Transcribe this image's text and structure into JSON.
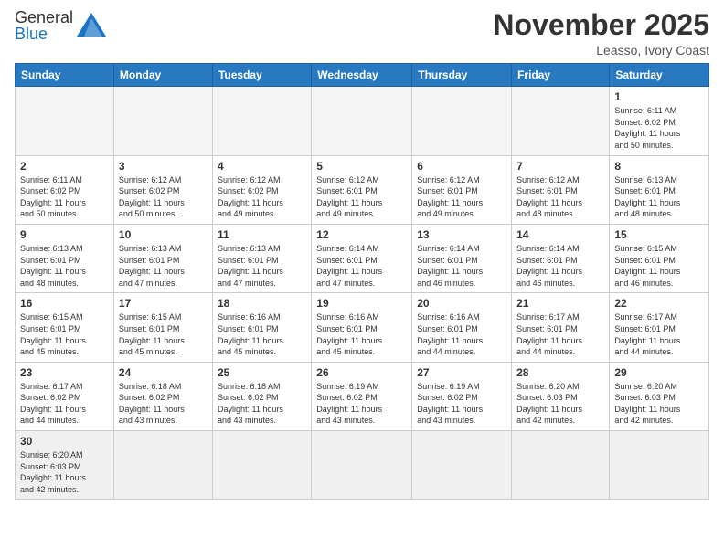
{
  "logo": {
    "text_general": "General",
    "text_blue": "Blue"
  },
  "title": "November 2025",
  "subtitle": "Leasso, Ivory Coast",
  "weekdays": [
    "Sunday",
    "Monday",
    "Tuesday",
    "Wednesday",
    "Thursday",
    "Friday",
    "Saturday"
  ],
  "weeks": [
    [
      {
        "day": "",
        "info": ""
      },
      {
        "day": "",
        "info": ""
      },
      {
        "day": "",
        "info": ""
      },
      {
        "day": "",
        "info": ""
      },
      {
        "day": "",
        "info": ""
      },
      {
        "day": "",
        "info": ""
      },
      {
        "day": "1",
        "info": "Sunrise: 6:11 AM\nSunset: 6:02 PM\nDaylight: 11 hours\nand 50 minutes."
      }
    ],
    [
      {
        "day": "2",
        "info": "Sunrise: 6:11 AM\nSunset: 6:02 PM\nDaylight: 11 hours\nand 50 minutes."
      },
      {
        "day": "3",
        "info": "Sunrise: 6:12 AM\nSunset: 6:02 PM\nDaylight: 11 hours\nand 50 minutes."
      },
      {
        "day": "4",
        "info": "Sunrise: 6:12 AM\nSunset: 6:02 PM\nDaylight: 11 hours\nand 49 minutes."
      },
      {
        "day": "5",
        "info": "Sunrise: 6:12 AM\nSunset: 6:01 PM\nDaylight: 11 hours\nand 49 minutes."
      },
      {
        "day": "6",
        "info": "Sunrise: 6:12 AM\nSunset: 6:01 PM\nDaylight: 11 hours\nand 49 minutes."
      },
      {
        "day": "7",
        "info": "Sunrise: 6:12 AM\nSunset: 6:01 PM\nDaylight: 11 hours\nand 48 minutes."
      },
      {
        "day": "8",
        "info": "Sunrise: 6:13 AM\nSunset: 6:01 PM\nDaylight: 11 hours\nand 48 minutes."
      }
    ],
    [
      {
        "day": "9",
        "info": "Sunrise: 6:13 AM\nSunset: 6:01 PM\nDaylight: 11 hours\nand 48 minutes."
      },
      {
        "day": "10",
        "info": "Sunrise: 6:13 AM\nSunset: 6:01 PM\nDaylight: 11 hours\nand 47 minutes."
      },
      {
        "day": "11",
        "info": "Sunrise: 6:13 AM\nSunset: 6:01 PM\nDaylight: 11 hours\nand 47 minutes."
      },
      {
        "day": "12",
        "info": "Sunrise: 6:14 AM\nSunset: 6:01 PM\nDaylight: 11 hours\nand 47 minutes."
      },
      {
        "day": "13",
        "info": "Sunrise: 6:14 AM\nSunset: 6:01 PM\nDaylight: 11 hours\nand 46 minutes."
      },
      {
        "day": "14",
        "info": "Sunrise: 6:14 AM\nSunset: 6:01 PM\nDaylight: 11 hours\nand 46 minutes."
      },
      {
        "day": "15",
        "info": "Sunrise: 6:15 AM\nSunset: 6:01 PM\nDaylight: 11 hours\nand 46 minutes."
      }
    ],
    [
      {
        "day": "16",
        "info": "Sunrise: 6:15 AM\nSunset: 6:01 PM\nDaylight: 11 hours\nand 45 minutes."
      },
      {
        "day": "17",
        "info": "Sunrise: 6:15 AM\nSunset: 6:01 PM\nDaylight: 11 hours\nand 45 minutes."
      },
      {
        "day": "18",
        "info": "Sunrise: 6:16 AM\nSunset: 6:01 PM\nDaylight: 11 hours\nand 45 minutes."
      },
      {
        "day": "19",
        "info": "Sunrise: 6:16 AM\nSunset: 6:01 PM\nDaylight: 11 hours\nand 45 minutes."
      },
      {
        "day": "20",
        "info": "Sunrise: 6:16 AM\nSunset: 6:01 PM\nDaylight: 11 hours\nand 44 minutes."
      },
      {
        "day": "21",
        "info": "Sunrise: 6:17 AM\nSunset: 6:01 PM\nDaylight: 11 hours\nand 44 minutes."
      },
      {
        "day": "22",
        "info": "Sunrise: 6:17 AM\nSunset: 6:01 PM\nDaylight: 11 hours\nand 44 minutes."
      }
    ],
    [
      {
        "day": "23",
        "info": "Sunrise: 6:17 AM\nSunset: 6:02 PM\nDaylight: 11 hours\nand 44 minutes."
      },
      {
        "day": "24",
        "info": "Sunrise: 6:18 AM\nSunset: 6:02 PM\nDaylight: 11 hours\nand 43 minutes."
      },
      {
        "day": "25",
        "info": "Sunrise: 6:18 AM\nSunset: 6:02 PM\nDaylight: 11 hours\nand 43 minutes."
      },
      {
        "day": "26",
        "info": "Sunrise: 6:19 AM\nSunset: 6:02 PM\nDaylight: 11 hours\nand 43 minutes."
      },
      {
        "day": "27",
        "info": "Sunrise: 6:19 AM\nSunset: 6:02 PM\nDaylight: 11 hours\nand 43 minutes."
      },
      {
        "day": "28",
        "info": "Sunrise: 6:20 AM\nSunset: 6:03 PM\nDaylight: 11 hours\nand 42 minutes."
      },
      {
        "day": "29",
        "info": "Sunrise: 6:20 AM\nSunset: 6:03 PM\nDaylight: 11 hours\nand 42 minutes."
      }
    ],
    [
      {
        "day": "30",
        "info": "Sunrise: 6:20 AM\nSunset: 6:03 PM\nDaylight: 11 hours\nand 42 minutes."
      },
      {
        "day": "",
        "info": ""
      },
      {
        "day": "",
        "info": ""
      },
      {
        "day": "",
        "info": ""
      },
      {
        "day": "",
        "info": ""
      },
      {
        "day": "",
        "info": ""
      },
      {
        "day": "",
        "info": ""
      }
    ]
  ]
}
